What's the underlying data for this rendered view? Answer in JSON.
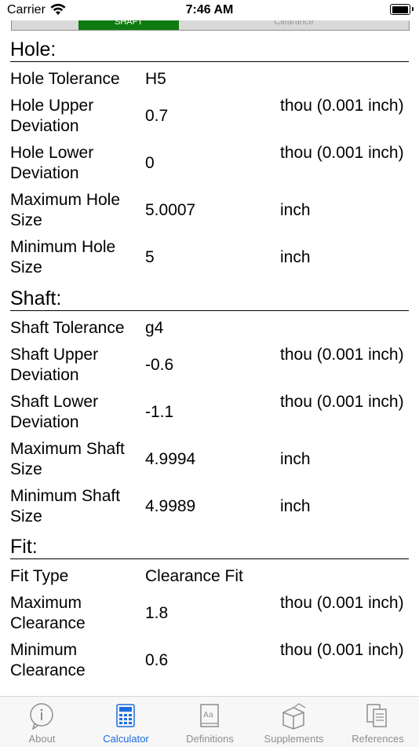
{
  "status_bar": {
    "carrier": "Carrier",
    "time": "7:46 AM"
  },
  "segmented": {
    "selected": "SHAFT",
    "other": "Clearance"
  },
  "hole": {
    "title": "Hole:",
    "rows": [
      {
        "label": "Hole Tolerance",
        "value": "H5",
        "unit": ""
      },
      {
        "label": "Hole Upper Deviation",
        "value": "0.7",
        "unit": "thou (0.001 inch)"
      },
      {
        "label": "Hole Lower Deviation",
        "value": "0",
        "unit": "thou (0.001 inch)"
      },
      {
        "label": "Maximum Hole Size",
        "value": "5.0007",
        "unit": "inch"
      },
      {
        "label": "Minimum Hole Size",
        "value": "5",
        "unit": "inch"
      }
    ]
  },
  "shaft": {
    "title": "Shaft:",
    "rows": [
      {
        "label": "Shaft Tolerance",
        "value": "g4",
        "unit": ""
      },
      {
        "label": "Shaft Upper Deviation",
        "value": "-0.6",
        "unit": "thou (0.001 inch)"
      },
      {
        "label": "Shaft Lower Deviation",
        "value": "-1.1",
        "unit": "thou (0.001 inch)"
      },
      {
        "label": "Maximum Shaft Size",
        "value": "4.9994",
        "unit": "inch"
      },
      {
        "label": "Minimum Shaft Size",
        "value": "4.9989",
        "unit": "inch"
      }
    ]
  },
  "fit": {
    "title": "Fit:",
    "rows": [
      {
        "label": "Fit Type",
        "value": "Clearance Fit",
        "unit": ""
      },
      {
        "label": "Maximum Clearance",
        "value": "1.8",
        "unit": "thou (0.001 inch)"
      },
      {
        "label": "Minimum Clearance",
        "value": "0.6",
        "unit": "thou (0.001 inch)"
      }
    ]
  },
  "tabbar": {
    "active": "calculator",
    "tabs": [
      {
        "id": "about",
        "label": "About",
        "icon": "info-icon"
      },
      {
        "id": "calculator",
        "label": "Calculator",
        "icon": "calculator-icon"
      },
      {
        "id": "definitions",
        "label": "Definitions",
        "icon": "dictionary-icon"
      },
      {
        "id": "supplements",
        "label": "Supplements",
        "icon": "box-icon"
      },
      {
        "id": "references",
        "label": "References",
        "icon": "books-icon"
      }
    ]
  },
  "colors": {
    "accent": "#1a6ce0",
    "segment_selected": "#0f7a0f",
    "tab_inactive": "#8e8e93"
  }
}
